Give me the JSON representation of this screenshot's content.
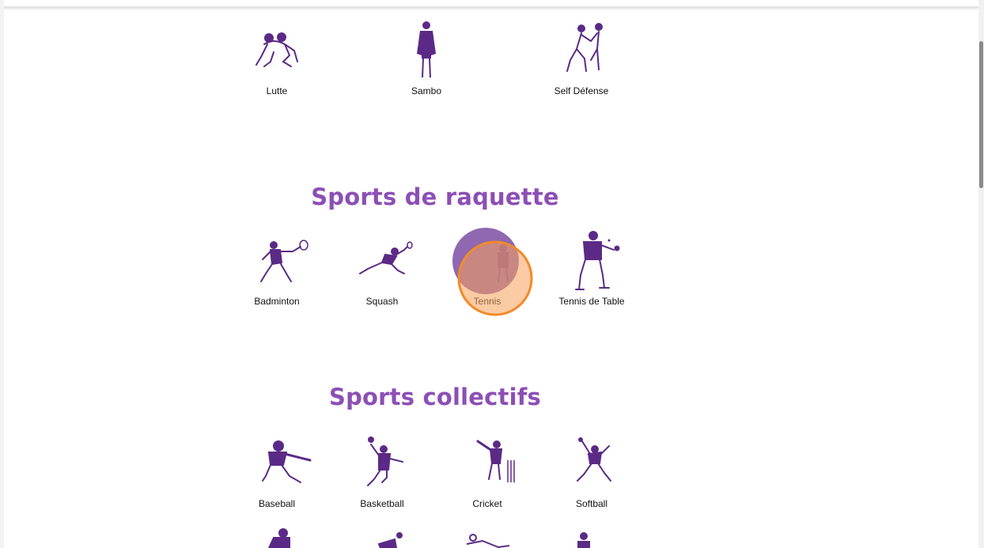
{
  "sections": {
    "combat": {
      "items": [
        {
          "label": "Lutte",
          "icon": "wrestling-icon"
        },
        {
          "label": "Sambo",
          "icon": "sambo-icon"
        },
        {
          "label": "Self Défense",
          "icon": "self-defense-icon"
        }
      ]
    },
    "racket": {
      "title": "Sports de raquette",
      "items": [
        {
          "label": "Badminton",
          "icon": "badminton-icon"
        },
        {
          "label": "Squash",
          "icon": "squash-icon"
        },
        {
          "label": "Tennis",
          "icon": "tennis-icon"
        },
        {
          "label": "Tennis de Table",
          "icon": "table-tennis-icon"
        }
      ]
    },
    "team": {
      "title": "Sports collectifs",
      "items": [
        {
          "label": "Baseball",
          "icon": "baseball-icon"
        },
        {
          "label": "Basketball",
          "icon": "basketball-icon"
        },
        {
          "label": "Cricket",
          "icon": "cricket-icon"
        },
        {
          "label": "Softball",
          "icon": "softball-icon"
        }
      ]
    }
  },
  "colors": {
    "accent": "#8c4fb5",
    "icon": "#5b2a86",
    "click_highlight": "#f7a15a"
  }
}
